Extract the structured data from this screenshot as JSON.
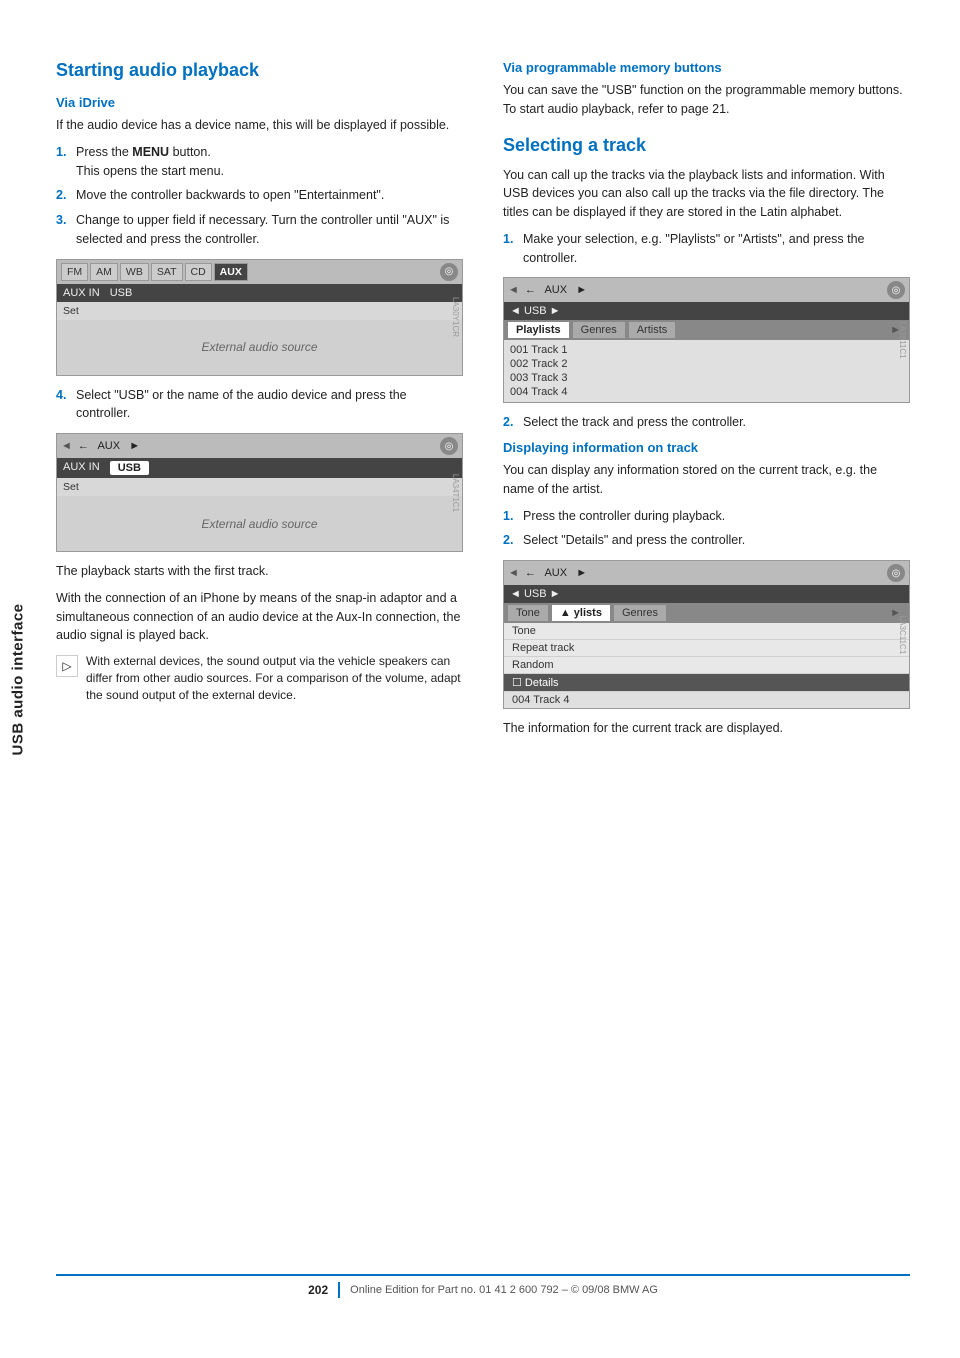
{
  "sidebar": {
    "label": "USB audio interface"
  },
  "left_col": {
    "section1_title": "Starting audio playback",
    "via_idrive_heading": "Via iDrive",
    "para1": "If the audio device has a device name, this will be displayed if possible.",
    "steps1": [
      {
        "num": "1.",
        "text": "Press the ",
        "bold": "MENU",
        "text2": " button.\nThis opens the start menu."
      },
      {
        "num": "2.",
        "text": "Move the controller backwards to open \"Entertainment\"."
      },
      {
        "num": "3.",
        "text": "Change to upper field if necessary. Turn the controller until \"AUX\" is selected and press the controller."
      }
    ],
    "step4": {
      "num": "4.",
      "text": "Select \"USB\" or the name of the audio device and press the controller."
    },
    "para_playback": "The playback starts with the first track.",
    "para_iphone": "With the connection of an iPhone by means of the snap-in adaptor and a simultaneous connection of an audio device at the Aux-In connection, the audio signal is played back.",
    "note_text": "With external devices, the sound output via the vehicle speakers can differ from other audio sources. For a comparison of the volume, adapt the sound output of the external device.",
    "screen1": {
      "tabs": [
        "FM",
        "AM",
        "WB",
        "SAT",
        "CD",
        "AUX"
      ],
      "active_tab": "AUX",
      "subtabs": [
        "AUX IN",
        "USB"
      ],
      "set_label": "Set",
      "body_text": "External audio source",
      "image_id": "LA30Y1CR"
    },
    "screen2": {
      "top_label": "◄ ← AUX ►",
      "subtabs": [
        "AUX IN",
        "USB"
      ],
      "active_subtab": "USB",
      "set_label": "Set",
      "body_text": "External audio source",
      "image_id": "LA34T1C1"
    }
  },
  "right_col": {
    "via_prog_heading": "Via programmable memory buttons",
    "via_prog_text": "You can save the \"USB\" function on the programmable memory buttons. To start audio playback, refer to page 21.",
    "section2_title": "Selecting a track",
    "selecting_para": "You can call up the tracks via the playback lists and information. With USB devices you can also call up the tracks via the file directory. The titles can be displayed if they are stored in the Latin alphabet.",
    "steps2": [
      {
        "num": "1.",
        "text": "Make your selection, e.g. \"Playlists\" or \"Artists\", and press the controller."
      }
    ],
    "step2_text": "Select the track and press the controller.",
    "plist_screen": {
      "top_label": "◄ ← AUX ►",
      "usb_label": "◄ USB ►",
      "tabs": [
        "Playlists",
        "Genres",
        "Artists"
      ],
      "active_tab": "Playlists",
      "items": [
        "001 Track 1",
        "002 Track 2",
        "003 Track 3",
        "004 Track 4"
      ],
      "image_id": "LA3811C1"
    },
    "disp_info_heading": "Displaying information on track",
    "disp_info_para": "You can display any information stored on the current track, e.g. the name of the artist.",
    "steps3": [
      {
        "num": "1.",
        "text": "Press the controller during playback."
      },
      {
        "num": "2.",
        "text": "Select \"Details\" and press the controller."
      }
    ],
    "det_screen": {
      "top_label": "◄ ← AUX ►",
      "usb_label": "◄ USB ►",
      "tabs_partial": [
        "Tone",
        "▲  ylists",
        "Genres"
      ],
      "menu_items": [
        "Tone",
        "Repeat track",
        "Random",
        "Details"
      ],
      "details_checked": true,
      "track_label": "004 Track 4",
      "image_id": "LA3C11C1"
    },
    "disp_info_result": "The information for the current track are displayed."
  },
  "footer": {
    "page_num": "202",
    "footer_text": "Online Edition for Part no. 01 41 2 600 792 – © 09/08 BMW AG"
  }
}
